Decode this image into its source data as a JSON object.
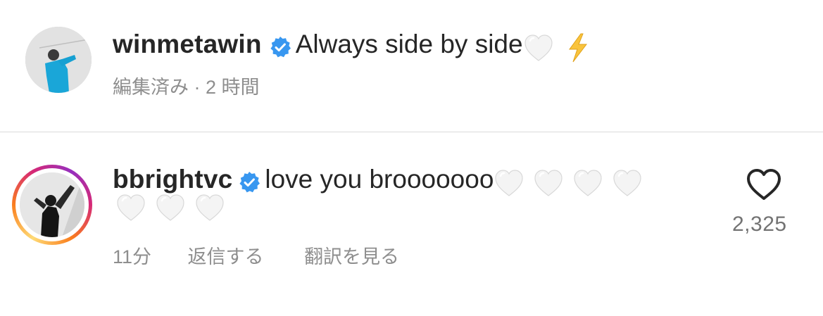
{
  "caption": {
    "username": "winmetawin",
    "verified": true,
    "text": "Always side by side",
    "emojis": [
      "white-heart",
      "high-voltage"
    ],
    "edited_label": "編集済み",
    "separator": "·",
    "time": "2 時間"
  },
  "comment": {
    "username": "bbright",
    "username_suffix": "vc",
    "verified": true,
    "text": "love you brooooooo",
    "emoji_line1": [
      "white-heart",
      "white-heart",
      "white-heart",
      "white-heart"
    ],
    "emoji_line2": [
      "white-heart",
      "white-heart",
      "white-heart"
    ],
    "time": "11分",
    "reply_label": "返信する",
    "translate_label": "翻訳を見る",
    "like_count": "2,325"
  },
  "colors": {
    "primary_text": "#262626",
    "secondary_text": "#8e8e8e",
    "verified_blue": "#3897f0",
    "divider": "#dbdbdb"
  }
}
